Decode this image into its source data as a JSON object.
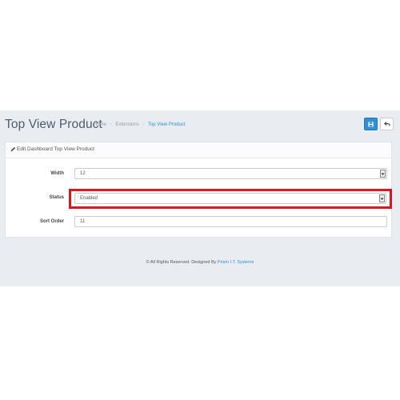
{
  "header": {
    "title": "Top View Product",
    "breadcrumb": [
      "Home",
      "Extensions",
      "Top View Product"
    ],
    "separator": "›"
  },
  "toolbar": {
    "save_icon": "save-icon",
    "back_icon": "back-icon"
  },
  "panel": {
    "title": "Edit Dashboard Top View Product",
    "icon": "pencil-icon"
  },
  "form": {
    "width": {
      "label": "Width",
      "value": "12"
    },
    "status": {
      "label": "Status",
      "value": "Enabled"
    },
    "sort_order": {
      "label": "Sort Order",
      "value": "11"
    }
  },
  "footer": {
    "text": "© All Rights Reserved. Designed By ",
    "link": "Prism I.T. Systems"
  },
  "colors": {
    "accent": "#2e8fd6",
    "highlight": "#e0161f",
    "page_bg": "#e9edf2"
  }
}
